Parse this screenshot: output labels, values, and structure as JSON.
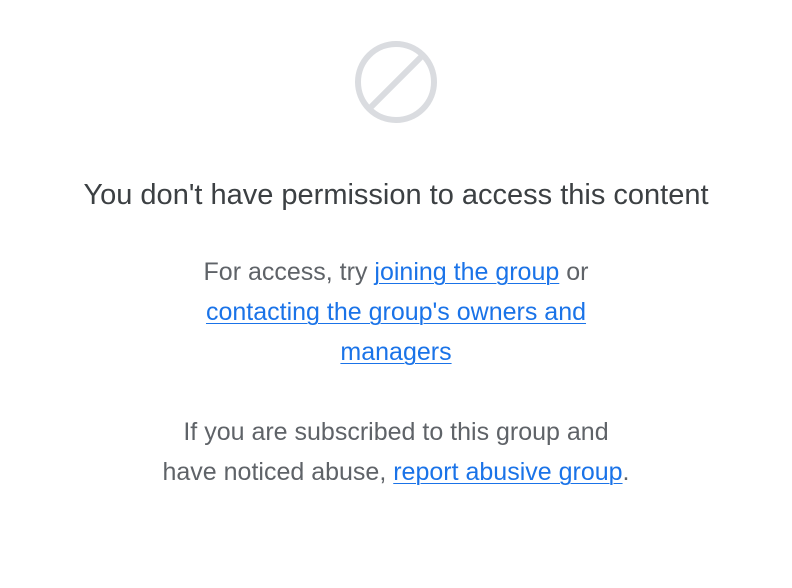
{
  "icon": "no-access-icon",
  "colors": {
    "icon": "#dadce0",
    "heading": "#3c4043",
    "body": "#5f6368",
    "link": "#1a73e8"
  },
  "heading": "You don't have permission to access this content",
  "access_message": {
    "prefix": "For access, try ",
    "join_link": "joining the group",
    "middle": " or",
    "contact_link_line1": "contacting the group's owners and",
    "contact_link_line2": "managers"
  },
  "abuse_message": {
    "line1": "If you are subscribed to this group and",
    "prefix": "have noticed abuse, ",
    "report_link": "report abusive group",
    "suffix": "."
  }
}
